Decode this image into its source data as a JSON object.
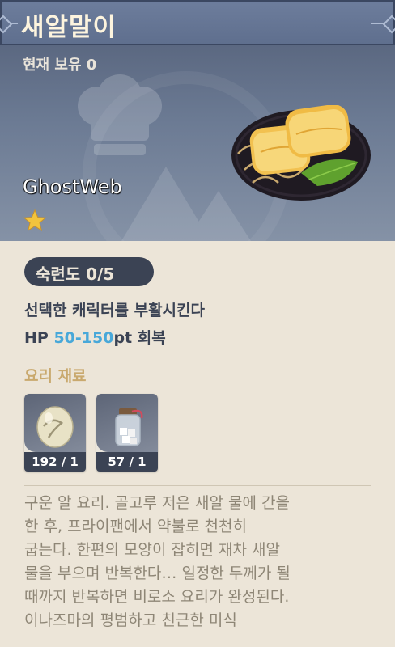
{
  "header": {
    "title": "새알말이"
  },
  "hero": {
    "owned_label": "현재 보유 0",
    "watermark": "GhostWeb",
    "rarity_stars": 1,
    "dish_icon": "rolled-omelette-dish-icon"
  },
  "mastery": {
    "label": "숙련도 0/5"
  },
  "effect": {
    "line1": "선택한 캐릭터를 부활시킨다",
    "hp_prefix": "HP ",
    "hp_value": "50-150",
    "hp_suffix": "pt 회복"
  },
  "materials": {
    "title": "요리 재료",
    "items": [
      {
        "icon": "bird-egg-icon",
        "count": "192 / 1"
      },
      {
        "icon": "sugar-jar-icon",
        "count": "57 / 1"
      }
    ]
  },
  "description": {
    "lines": [
      "구운 알 요리. 골고루 저은 새알 물에 간을",
      "한 후, 프라이팬에서 약불로 천천히",
      "굽는다. 한편의 모양이 잡히면 재차 새알",
      "물을 부으며 반복한다… 일정한 두께가 될",
      "때까지 반복하면 비로소 요리가 완성된다.",
      "이나즈마의 평범하고 친근한 미식"
    ]
  },
  "colors": {
    "header_bg": "#6d7d9c",
    "panel_bg": "#ece5d8",
    "hp_accent": "#48a8d9",
    "materials_title": "#c9a96e",
    "star": "#f2c43d"
  }
}
